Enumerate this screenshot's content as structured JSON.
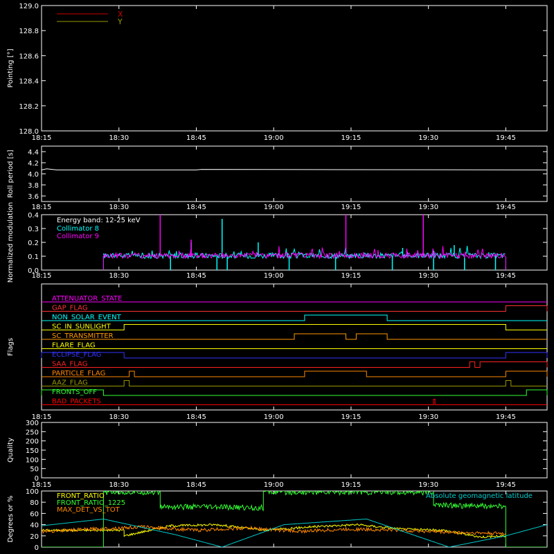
{
  "time_ticks": [
    "18:15",
    "18:30",
    "18:45",
    "19:00",
    "19:15",
    "19:30",
    "19:45"
  ],
  "time_range": [
    "18:15",
    "19:53"
  ],
  "chart_data": [
    {
      "type": "line",
      "ylabel": "Pointing [°]",
      "ylim": [
        128.0,
        129.0
      ],
      "yticks": [
        "128.0",
        "128.2",
        "128.4",
        "128.6",
        "128.8",
        "129.0"
      ],
      "legend_placement": "top-left",
      "series": [
        {
          "name": "X",
          "color": "#cc0000",
          "values": []
        },
        {
          "name": "Y",
          "color": "#999900",
          "values": []
        }
      ]
    },
    {
      "type": "line",
      "ylabel": "Roll period [s]",
      "ylim": [
        3.5,
        4.5
      ],
      "yticks": [
        "3.6",
        "3.8",
        "4.0",
        "4.2",
        "4.4"
      ],
      "series": [
        {
          "color": "#ffffff",
          "x": [
            "18:15",
            "18:16",
            "18:17",
            "18:18",
            "18:45",
            "18:46",
            "19:53"
          ],
          "values": [
            4.07,
            4.09,
            4.08,
            4.07,
            4.07,
            4.08,
            4.07
          ]
        }
      ]
    },
    {
      "type": "line",
      "ylabel": "Normalized modulation",
      "ylim": [
        0,
        0.4
      ],
      "yticks": [
        "0.0",
        "0.1",
        "0.2",
        "0.3",
        "0.4"
      ],
      "annotation": "Energy band: 12-25 keV",
      "legend_placement": "top-left",
      "start": "18:27",
      "end": "19:45",
      "baseline": 0.1,
      "series": [
        {
          "name": "Collimator 8",
          "color": "#00ffff",
          "spikes": [
            {
              "x": "18:44",
              "value": 0.2
            },
            {
              "x": "18:50",
              "value": 0.37
            },
            {
              "x": "18:57",
              "value": 0.2
            },
            {
              "x": "19:14",
              "value": 0.16
            },
            {
              "x": "19:25",
              "value": 0.16
            },
            {
              "x": "19:35",
              "value": 0.18
            }
          ],
          "dips": [
            "18:40",
            "18:49",
            "18:51",
            "19:03",
            "19:12",
            "19:23",
            "19:31",
            "19:37",
            "19:43"
          ]
        },
        {
          "name": "Collimator 9",
          "color": "#ff00ff",
          "spikes": [
            {
              "x": "18:38",
              "value": 0.4
            },
            {
              "x": "18:44",
              "value": 0.22
            },
            {
              "x": "19:14",
              "value": 0.4
            },
            {
              "x": "19:29",
              "value": 0.4
            }
          ],
          "dips": []
        }
      ]
    },
    {
      "type": "line",
      "ylabel": "Flags",
      "flags": [
        {
          "name": "ATTENUATOR_STATE",
          "color": "#ff00ff",
          "high": []
        },
        {
          "name": "GAP_FLAG",
          "color": "#ff3333",
          "high": [
            [
              "19:45",
              "19:53"
            ]
          ]
        },
        {
          "name": "NON_SOLAR_EVENT",
          "color": "#00ffff",
          "high": [
            [
              "19:06",
              "19:22"
            ]
          ]
        },
        {
          "name": "SC_IN_SUNLIGHT",
          "color": "#ffff00",
          "high": [
            [
              "18:31",
              "19:45"
            ]
          ]
        },
        {
          "name": "SC_TRANSMITTER",
          "color": "#ff9900",
          "high": [
            [
              "19:04",
              "19:14"
            ],
            [
              "19:16",
              "19:22"
            ]
          ]
        },
        {
          "name": "FLARE_FLAG",
          "color": "#ffff00",
          "high": []
        },
        {
          "name": "ECLIPSE_FLAG",
          "color": "#3333ff",
          "high": [
            [
              "18:15",
              "18:31"
            ],
            [
              "19:45",
              "19:53"
            ]
          ]
        },
        {
          "name": "SAA_FLAG",
          "color": "#ff2222",
          "high": [
            [
              "19:38",
              "19:39"
            ],
            [
              "19:40",
              "19:53"
            ]
          ]
        },
        {
          "name": "PARTICLE_FLAG",
          "color": "#ff8800",
          "high": [
            [
              "18:32",
              "18:33"
            ],
            [
              "19:06",
              "19:18"
            ],
            [
              "19:45",
              "19:53"
            ]
          ]
        },
        {
          "name": "AAZ_FLAG",
          "color": "#999900",
          "high": [
            [
              "18:31",
              "18:32"
            ],
            [
              "19:45",
              "19:46"
            ]
          ]
        },
        {
          "name": "FRONTS_OFF",
          "color": "#33ff33",
          "high": [
            [
              "18:15",
              "18:27"
            ],
            [
              "19:49",
              "19:53"
            ]
          ]
        },
        {
          "name": "BAD_PACKETS",
          "color": "#ff0000",
          "high": [
            [
              "19:31",
              "19:31"
            ]
          ]
        }
      ]
    },
    {
      "type": "line",
      "ylabel": "Quality",
      "ylim": [
        0,
        300
      ],
      "yticks": [
        "0",
        "50",
        "100",
        "150",
        "200",
        "250",
        "300"
      ],
      "series": []
    },
    {
      "type": "line",
      "ylabel": "Degrees or %",
      "ylim": [
        0,
        100
      ],
      "yticks": [
        "0",
        "20",
        "40",
        "60",
        "80",
        "100"
      ],
      "legend_placement": "top-left",
      "right_label": "Absolute geomagnetic latitude",
      "series": [
        {
          "name": "FRONT_RATIO",
          "color": "#ffff00",
          "x": [
            "18:15",
            "18:27",
            "18:27",
            "18:31",
            "18:31",
            "18:40",
            "18:49",
            "18:58",
            "19:07",
            "19:16",
            "19:25",
            "19:33",
            "19:40",
            "19:45"
          ],
          "values": [
            30,
            30,
            30,
            30,
            20,
            38,
            40,
            30,
            36,
            40,
            32,
            30,
            18,
            20
          ]
        },
        {
          "name": "FRONT_RATIO_1225",
          "color": "#33ff33",
          "x": [
            "18:15",
            "18:27",
            "18:27",
            "18:38",
            "18:38",
            "18:58",
            "18:58",
            "19:31",
            "19:31",
            "19:45",
            "19:45",
            "19:53"
          ],
          "values": [
            0,
            0,
            98,
            98,
            72,
            70,
            98,
            98,
            75,
            72,
            0,
            0
          ]
        },
        {
          "name": "MAX_DET_VS_TOT",
          "color": "#ff8800",
          "x": [
            "18:15",
            "18:25",
            "18:35",
            "18:45",
            "18:55",
            "19:05",
            "19:15",
            "19:25",
            "19:35",
            "19:45"
          ],
          "values": [
            28,
            32,
            36,
            30,
            34,
            28,
            32,
            30,
            26,
            24
          ]
        },
        {
          "name": "Absolute geomagnetic latitude",
          "color": "#00cccc",
          "x": [
            "18:15",
            "18:27",
            "18:41",
            "18:50",
            "19:02",
            "19:18",
            "19:34",
            "19:45",
            "19:53"
          ],
          "values": [
            38,
            50,
            22,
            0,
            40,
            50,
            0,
            20,
            40
          ]
        }
      ]
    }
  ]
}
